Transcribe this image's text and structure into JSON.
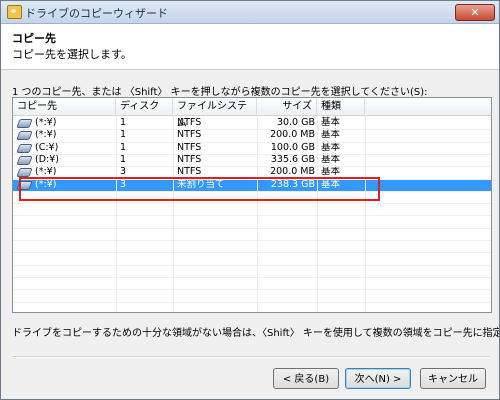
{
  "window": {
    "title": "ドライブのコピーウィザード",
    "close_label": "✕"
  },
  "header": {
    "title": "コピー先",
    "subtitle": "コピー先を選択します。"
  },
  "instruction": "1 つのコピー先、または 〈Shift〉 キーを押しながら複数のコピー先を選択してください(S):",
  "table": {
    "columns": [
      "コピー先",
      "ディスク",
      "ファイルシステム",
      "サイズ",
      "種類"
    ],
    "rows": [
      {
        "dest": "(*:¥)",
        "disk": "1",
        "fs": "NTFS",
        "size": "30.0 GB",
        "type": "基本",
        "selected": false
      },
      {
        "dest": "(*:¥)",
        "disk": "1",
        "fs": "NTFS",
        "size": "200.0 MB",
        "type": "基本",
        "selected": false
      },
      {
        "dest": "(C:¥)",
        "disk": "1",
        "fs": "NTFS",
        "size": "100.0 GB",
        "type": "基本",
        "selected": false
      },
      {
        "dest": "(D:¥)",
        "disk": "1",
        "fs": "NTFS",
        "size": "335.6 GB",
        "type": "基本",
        "selected": false
      },
      {
        "dest": "(*:¥)",
        "disk": "3",
        "fs": "NTFS",
        "size": "200.0 MB",
        "type": "基本",
        "selected": false
      },
      {
        "dest": "(*:¥)",
        "disk": "3",
        "fs": "未割り当て",
        "size": "238.3 GB",
        "type": "基本",
        "selected": true
      }
    ]
  },
  "footnote": "ドライブをコピーするための十分な領域がない場合は、〈Shift〉 キーを使用して複数の領域をコピー先に指定できます。",
  "buttons": {
    "back": "< 戻る(B)",
    "next": "次へ(N) >",
    "cancel": "キャンセル"
  },
  "icons": {
    "drive": "drive-icon",
    "app": "wizard-icon"
  },
  "colors": {
    "selection": "#3399ff",
    "highlight_box": "#e02020"
  }
}
